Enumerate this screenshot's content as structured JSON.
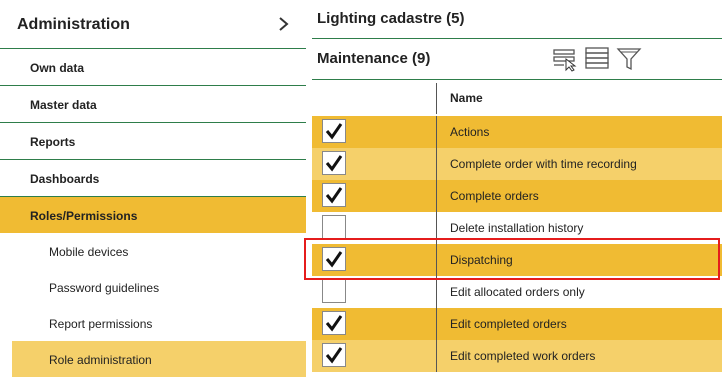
{
  "sidebar": {
    "title": "Administration",
    "items": [
      {
        "label": "Own data"
      },
      {
        "label": "Master data"
      },
      {
        "label": "Reports"
      },
      {
        "label": "Dashboards"
      },
      {
        "label": "Roles/Permissions"
      }
    ],
    "subitems": [
      {
        "label": "Mobile devices"
      },
      {
        "label": "Password guidelines"
      },
      {
        "label": "Report permissions"
      },
      {
        "label": "Role administration"
      }
    ]
  },
  "main": {
    "title": "Lighting cadastre (5)",
    "subtitle": "Maintenance (9)",
    "column_header": "Name",
    "rows": [
      {
        "name": "Actions",
        "checked": true
      },
      {
        "name": "Complete order with time recording",
        "checked": true
      },
      {
        "name": "Complete orders",
        "checked": true
      },
      {
        "name": "Delete installation history",
        "checked": false
      },
      {
        "name": "Dispatching",
        "checked": true
      },
      {
        "name": "Edit allocated orders only",
        "checked": false
      },
      {
        "name": "Edit completed orders",
        "checked": true
      },
      {
        "name": "Edit completed work orders",
        "checked": true
      }
    ]
  },
  "colors": {
    "accent": "#f0bb33",
    "accent_light": "#f5d06a",
    "divider": "#2e7d4a",
    "highlight": "#e51c1c"
  }
}
